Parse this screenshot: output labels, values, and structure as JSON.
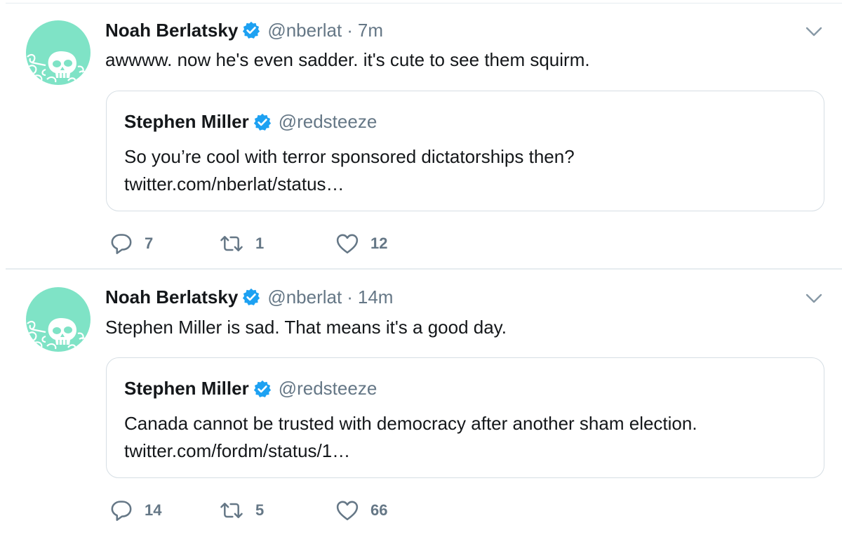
{
  "tweets": [
    {
      "author": {
        "name": "Noah Berlatsky",
        "handle": "@nberlat"
      },
      "separator": "·",
      "time": "7m",
      "text": "awwww. now he's even sadder. it's cute to see them squirm.",
      "quoted": {
        "author": {
          "name": "Stephen Miller",
          "handle": "@redsteeze"
        },
        "lines": [
          "So you’re cool with terror sponsored dictatorships then?",
          "twitter.com/nberlat/status…"
        ]
      },
      "stats": {
        "replies": "7",
        "retweets": "1",
        "likes": "12"
      }
    },
    {
      "author": {
        "name": "Noah Berlatsky",
        "handle": "@nberlat"
      },
      "separator": "·",
      "time": "14m",
      "text": "Stephen Miller is sad. That means it's a good day.",
      "quoted": {
        "author": {
          "name": "Stephen Miller",
          "handle": "@redsteeze"
        },
        "lines": [
          "Canada cannot be trusted with democracy after another sham election.",
          "twitter.com/fordm/status/1…"
        ]
      },
      "stats": {
        "replies": "14",
        "retweets": "5",
        "likes": "66"
      }
    }
  ],
  "icons": {
    "verified": "verified-badge-icon",
    "caret": "chevron-down-icon",
    "reply": "reply-icon",
    "retweet": "retweet-icon",
    "like": "heart-icon"
  },
  "colors": {
    "verified": "#1da1f2",
    "secondary_text": "#657786",
    "avatar_bg": "#7fe3c6",
    "avatar_art": "#ffffff"
  }
}
